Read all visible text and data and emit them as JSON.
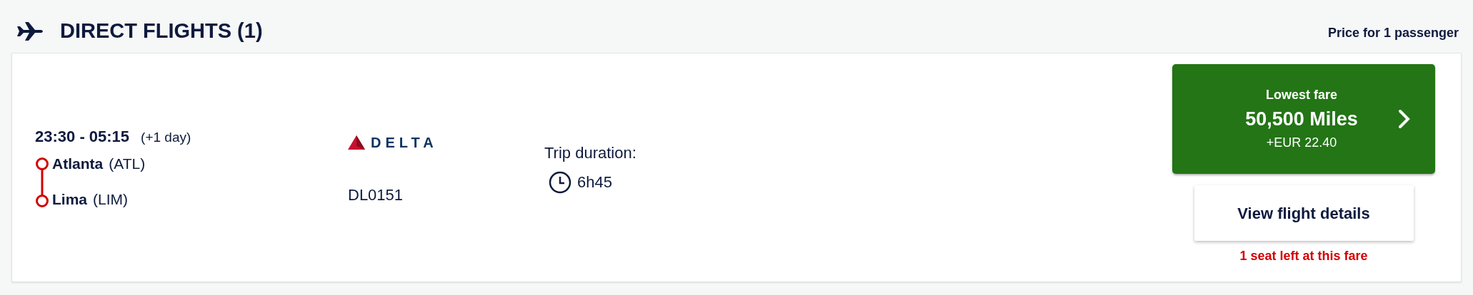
{
  "header": {
    "title": "DIRECT FLIGHTS (1)",
    "price_note": "Price for 1 passenger"
  },
  "flight": {
    "times": "23:30 - 05:15",
    "day_offset": "(+1 day)",
    "stops": [
      {
        "city": "Atlanta",
        "code": "(ATL)"
      },
      {
        "city": "Lima",
        "code": "(LIM)"
      }
    ],
    "airline": {
      "name": "DELTA",
      "flight_number": "DL0151"
    },
    "duration": {
      "label": "Trip duration:",
      "value": "6h45"
    },
    "fare": {
      "label": "Lowest fare",
      "miles": "50,500 Miles",
      "surcharge": "+EUR 22.40"
    },
    "details_button": "View flight details",
    "seats_warning": "1 seat left at this fare"
  }
}
